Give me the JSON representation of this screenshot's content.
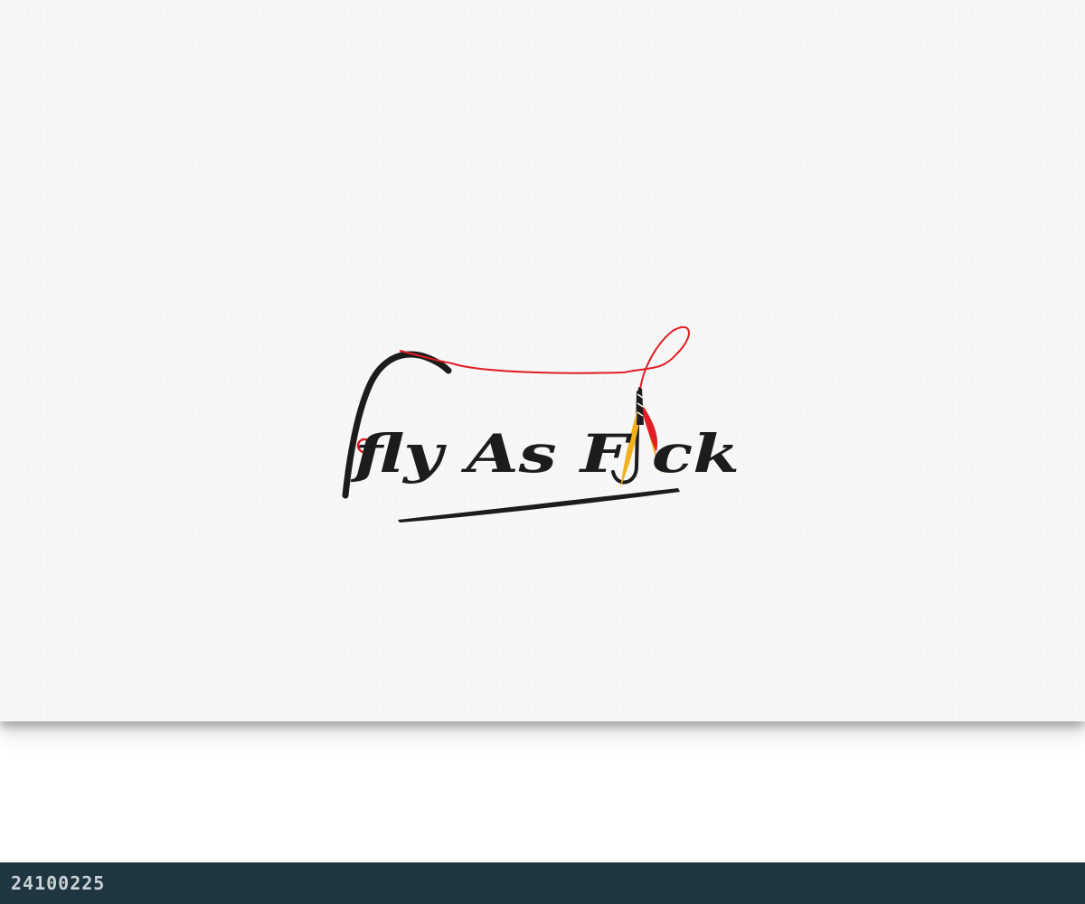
{
  "logo": {
    "wordmark": "fly As F ck",
    "colors": {
      "ink": "#1c1c1c",
      "line": "#e01e24",
      "feather_red": "#e01e24",
      "feather_yellow": "#f2b01e"
    }
  },
  "footer": {
    "id": "24100225",
    "background": "#1f3640"
  }
}
